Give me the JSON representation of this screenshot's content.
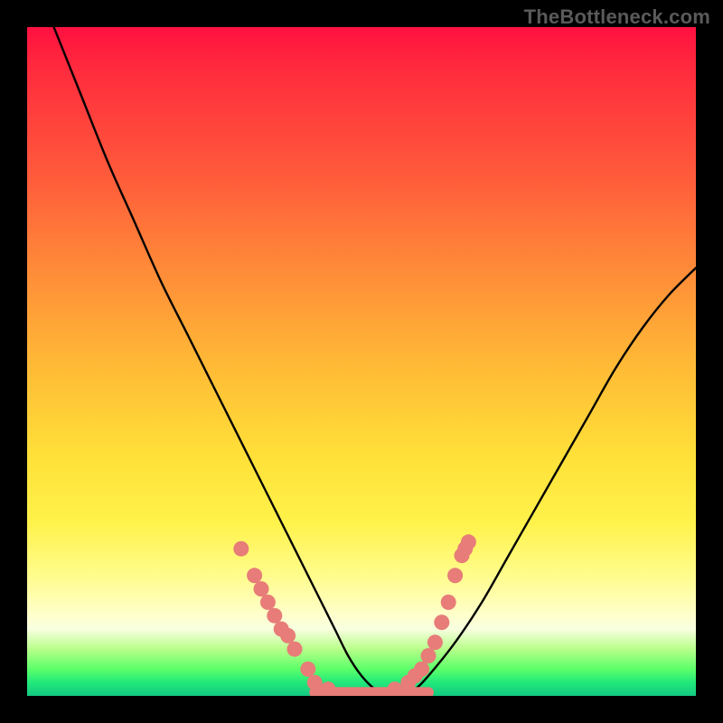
{
  "watermark": "TheBottleneck.com",
  "chart_data": {
    "type": "line",
    "title": "",
    "xlabel": "",
    "ylabel": "",
    "xlim": [
      0,
      100
    ],
    "ylim": [
      0,
      100
    ],
    "grid": false,
    "legend": false,
    "series": [
      {
        "name": "bottleneck-curve",
        "color": "#000000",
        "x": [
          4,
          8,
          12,
          16,
          20,
          24,
          28,
          32,
          36,
          38,
          40,
          42,
          44,
          46,
          48,
          50,
          52,
          54,
          56,
          58,
          60,
          64,
          68,
          72,
          76,
          80,
          84,
          88,
          92,
          96,
          100
        ],
        "y": [
          100,
          90,
          80,
          71,
          62,
          54,
          46,
          38,
          30,
          26,
          22,
          18,
          14,
          10,
          6,
          3,
          1,
          0,
          0,
          1,
          3,
          8,
          14,
          21,
          28,
          35,
          42,
          49,
          55,
          60,
          64
        ]
      },
      {
        "name": "flat-bottom",
        "color": "#e77c78",
        "x": [
          43,
          60
        ],
        "y": [
          0.5,
          0.5
        ]
      }
    ],
    "markers": {
      "name": "highlight-points",
      "color": "#e77c78",
      "points": [
        {
          "x": 32,
          "y": 22
        },
        {
          "x": 34,
          "y": 18
        },
        {
          "x": 35,
          "y": 16
        },
        {
          "x": 36,
          "y": 14
        },
        {
          "x": 37,
          "y": 12
        },
        {
          "x": 38,
          "y": 10
        },
        {
          "x": 39,
          "y": 9
        },
        {
          "x": 40,
          "y": 7
        },
        {
          "x": 42,
          "y": 4
        },
        {
          "x": 43,
          "y": 2
        },
        {
          "x": 45,
          "y": 1
        },
        {
          "x": 55,
          "y": 1
        },
        {
          "x": 57,
          "y": 2
        },
        {
          "x": 58,
          "y": 3
        },
        {
          "x": 59,
          "y": 4
        },
        {
          "x": 60,
          "y": 6
        },
        {
          "x": 61,
          "y": 8
        },
        {
          "x": 62,
          "y": 11
        },
        {
          "x": 63,
          "y": 14
        },
        {
          "x": 64,
          "y": 18
        },
        {
          "x": 65,
          "y": 21
        },
        {
          "x": 65.5,
          "y": 22
        },
        {
          "x": 66,
          "y": 23
        }
      ]
    }
  }
}
